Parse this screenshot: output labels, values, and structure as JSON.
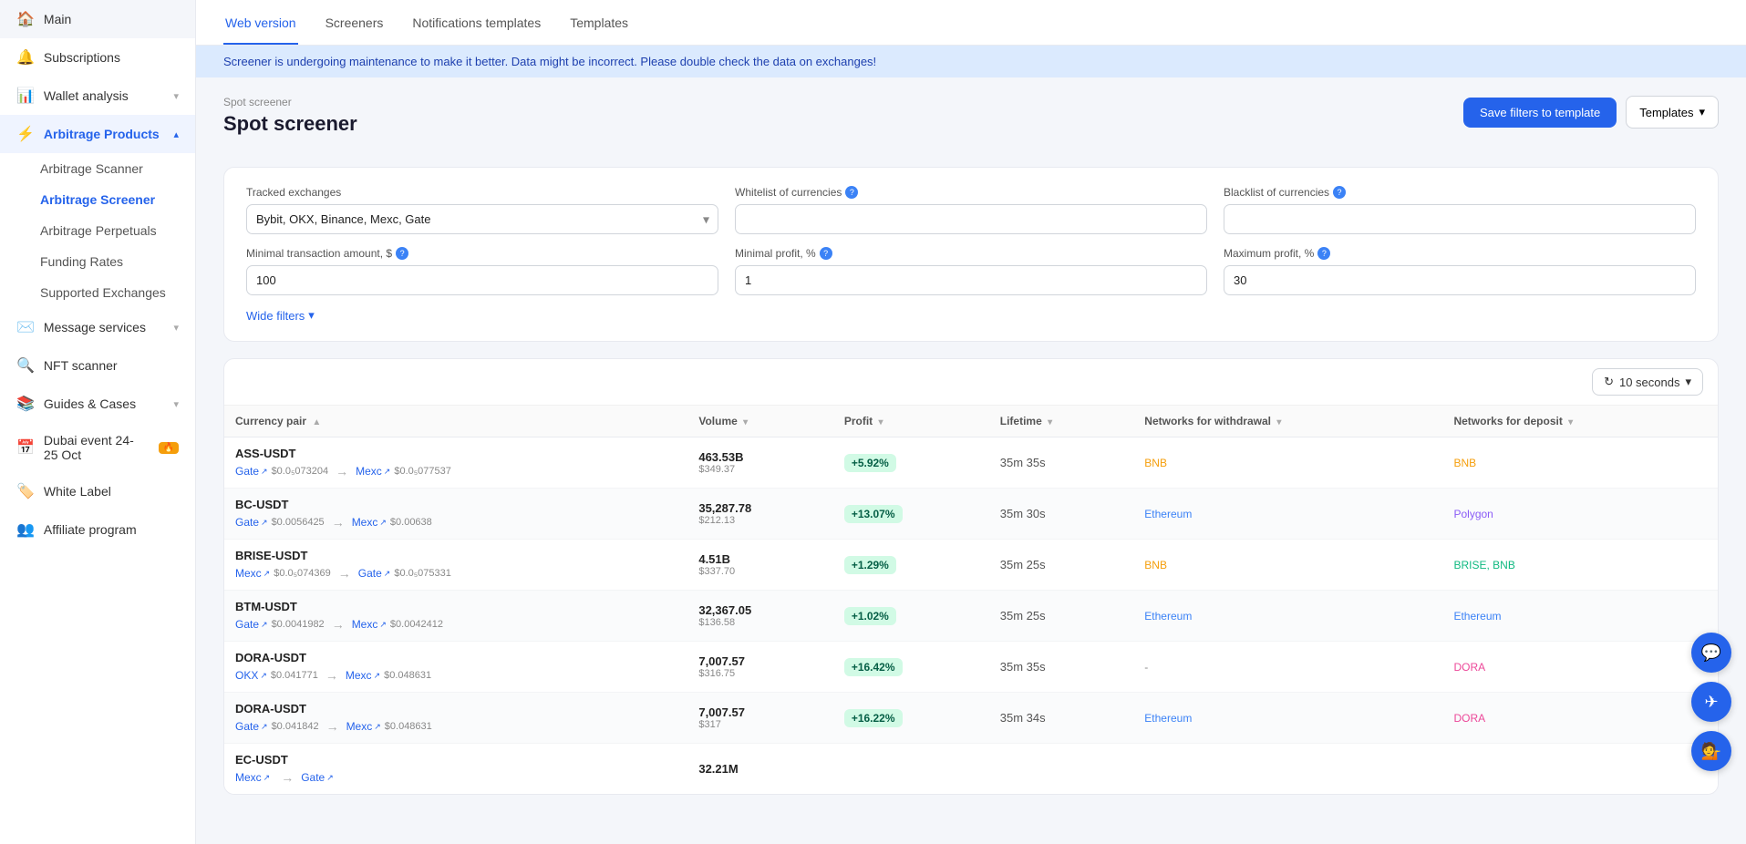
{
  "sidebar": {
    "items": [
      {
        "id": "main",
        "label": "Main",
        "icon": "🏠",
        "hasChevron": false
      },
      {
        "id": "subscriptions",
        "label": "Subscriptions",
        "icon": "🔔",
        "hasChevron": false
      },
      {
        "id": "wallet-analysis",
        "label": "Wallet analysis",
        "icon": "📊",
        "hasChevron": true
      },
      {
        "id": "arbitrage-products",
        "label": "Arbitrage Products",
        "icon": "⚡",
        "hasChevron": true,
        "active": true,
        "expanded": true
      },
      {
        "id": "message-services",
        "label": "Message services",
        "icon": "✉️",
        "hasChevron": true
      },
      {
        "id": "nft-scanner",
        "label": "NFT scanner",
        "icon": "🔍",
        "hasChevron": false
      },
      {
        "id": "guides-cases",
        "label": "Guides & Cases",
        "icon": "📚",
        "hasChevron": true
      },
      {
        "id": "dubai-event",
        "label": "Dubai event 24-25 Oct",
        "icon": "📅",
        "hasChevron": false
      },
      {
        "id": "white-label",
        "label": "White Label",
        "icon": "🏷️",
        "hasChevron": false
      },
      {
        "id": "affiliate",
        "label": "Affiliate program",
        "icon": "👥",
        "hasChevron": false
      }
    ],
    "sub_items": [
      {
        "id": "arbitrage-scanner",
        "label": "Arbitrage Scanner"
      },
      {
        "id": "arbitrage-screener",
        "label": "Arbitrage Screener",
        "active": true
      },
      {
        "id": "arbitrage-perpetuals",
        "label": "Arbitrage Perpetuals"
      },
      {
        "id": "funding-rates",
        "label": "Funding Rates"
      },
      {
        "id": "supported-exchanges",
        "label": "Supported Exchanges"
      }
    ]
  },
  "topnav": {
    "tabs": [
      {
        "id": "web-version",
        "label": "Web version",
        "active": true
      },
      {
        "id": "screeners",
        "label": "Screeners"
      },
      {
        "id": "notifications-templates",
        "label": "Notifications templates"
      },
      {
        "id": "templates",
        "label": "Templates"
      }
    ]
  },
  "alert": {
    "message": "Screener is undergoing maintenance to make it better. Data might be incorrect. Please double check the data on exchanges!"
  },
  "header": {
    "breadcrumb": "Spot screener",
    "title": "Spot screener",
    "save_btn": "Save filters to template",
    "templates_btn": "Templates"
  },
  "filters": {
    "tracked_exchanges_label": "Tracked exchanges",
    "tracked_exchanges_value": "Bybit, OKX, Binance, Mexc, Gate",
    "whitelist_label": "Whitelist of currencies",
    "blacklist_label": "Blacklist of currencies",
    "min_transaction_label": "Minimal transaction amount, $",
    "min_transaction_value": "100",
    "min_profit_label": "Minimal profit, %",
    "min_profit_value": "1",
    "max_profit_label": "Maximum profit, %",
    "max_profit_value": "30",
    "wide_filters_label": "Wide filters"
  },
  "table": {
    "refresh_label": "10 seconds",
    "columns": [
      {
        "id": "currency-pair",
        "label": "Currency pair",
        "sortable": true,
        "sort": "asc"
      },
      {
        "id": "volume",
        "label": "Volume",
        "sortable": true
      },
      {
        "id": "profit",
        "label": "Profit",
        "sortable": true
      },
      {
        "id": "lifetime",
        "label": "Lifetime",
        "sortable": true
      },
      {
        "id": "networks-withdrawal",
        "label": "Networks for withdrawal",
        "sortable": true
      },
      {
        "id": "networks-deposit",
        "label": "Networks for deposit",
        "sortable": true
      }
    ],
    "rows": [
      {
        "pair": "ASS-USDT",
        "from_exchange": "Gate",
        "from_price": "$0.0₅073204",
        "to_exchange": "Mexc",
        "to_price": "$0.0₅077537",
        "volume": "463.53B",
        "volume_usd": "$349.37",
        "profit": "+5.92%",
        "lifetime": "35m 35s",
        "networks_withdrawal": "BNB",
        "networks_withdrawal_color": "bnb",
        "networks_deposit": "BNB",
        "networks_deposit_color": "bnb"
      },
      {
        "pair": "BC-USDT",
        "from_exchange": "Gate",
        "from_price": "$0.0056425",
        "to_exchange": "Mexc",
        "to_price": "$0.00638",
        "volume": "35,287.78",
        "volume_usd": "$212.13",
        "profit": "+13.07%",
        "lifetime": "35m 30s",
        "networks_withdrawal": "Ethereum",
        "networks_withdrawal_color": "eth",
        "networks_deposit": "Polygon",
        "networks_deposit_color": "poly"
      },
      {
        "pair": "BRISE-USDT",
        "from_exchange": "Mexc",
        "from_price": "$0.0₅074369",
        "to_exchange": "Gate",
        "to_price": "$0.0₅075331",
        "volume": "4.51B",
        "volume_usd": "$337.70",
        "profit": "+1.29%",
        "lifetime": "35m 25s",
        "networks_withdrawal": "BNB",
        "networks_withdrawal_color": "bnb",
        "networks_deposit": "BRISE, BNB",
        "networks_deposit_color": "brise"
      },
      {
        "pair": "BTM-USDT",
        "from_exchange": "Gate",
        "from_price": "$0.0041982",
        "to_exchange": "Mexc",
        "to_price": "$0.0042412",
        "volume": "32,367.05",
        "volume_usd": "$136.58",
        "profit": "+1.02%",
        "lifetime": "35m 25s",
        "networks_withdrawal": "Ethereum",
        "networks_withdrawal_color": "eth",
        "networks_deposit": "Ethereum",
        "networks_deposit_color": "eth"
      },
      {
        "pair": "DORA-USDT",
        "from_exchange": "OKX",
        "from_price": "$0.041771",
        "to_exchange": "Mexc",
        "to_price": "$0.048631",
        "volume": "7,007.57",
        "volume_usd": "$316.75",
        "profit": "+16.42%",
        "lifetime": "35m 35s",
        "networks_withdrawal": "-",
        "networks_withdrawal_color": "dash",
        "networks_deposit": "DORA",
        "networks_deposit_color": "dora"
      },
      {
        "pair": "DORA-USDT",
        "from_exchange": "Gate",
        "from_price": "$0.041842",
        "to_exchange": "Mexc",
        "to_price": "$0.048631",
        "volume": "7,007.57",
        "volume_usd": "$317",
        "profit": "+16.22%",
        "lifetime": "35m 34s",
        "networks_withdrawal": "Ethereum",
        "networks_withdrawal_color": "eth",
        "networks_deposit": "DORA",
        "networks_deposit_color": "dora"
      },
      {
        "pair": "EC-USDT",
        "from_exchange": "Mexc",
        "from_price": "",
        "to_exchange": "Gate",
        "to_price": "",
        "volume": "32.21M",
        "volume_usd": "",
        "profit": "",
        "lifetime": "",
        "networks_withdrawal": "",
        "networks_withdrawal_color": "",
        "networks_deposit": "",
        "networks_deposit_color": ""
      }
    ]
  }
}
